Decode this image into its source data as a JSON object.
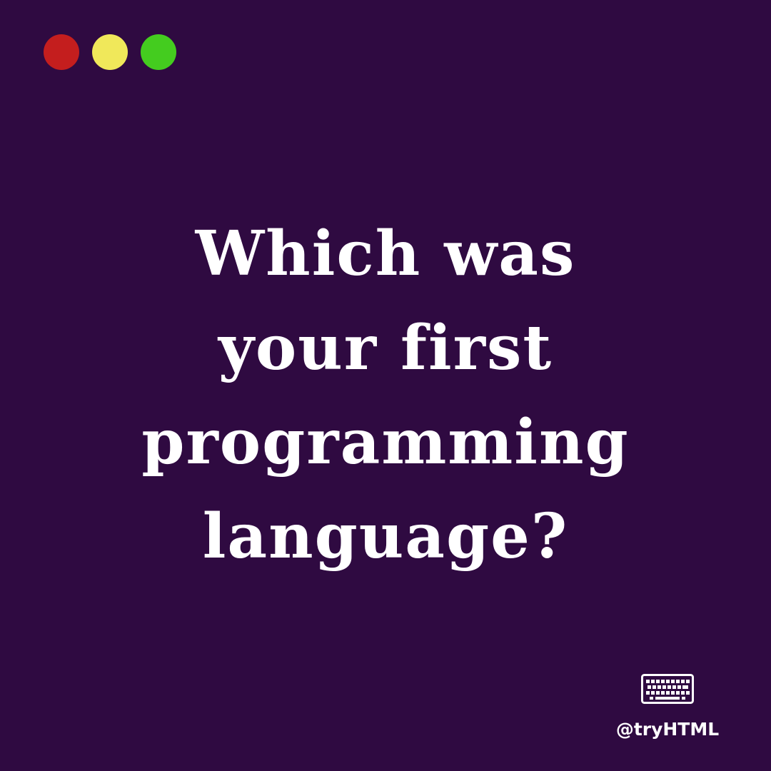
{
  "colors": {
    "background": "#2f0a41",
    "dot_red": "#c41e1e",
    "dot_yellow": "#f0e85a",
    "dot_green": "#44cc1f",
    "text": "#ffffff"
  },
  "window_controls": [
    {
      "name": "red-dot",
      "color": "#c41e1e"
    },
    {
      "name": "yellow-dot",
      "color": "#f0e85a"
    },
    {
      "name": "green-dot",
      "color": "#44cc1f"
    }
  ],
  "headline": {
    "lines": [
      "Which was",
      "your first",
      "programming",
      "language?"
    ]
  },
  "brand": {
    "icon": "keyboard-icon",
    "handle": "@tryHTML"
  }
}
